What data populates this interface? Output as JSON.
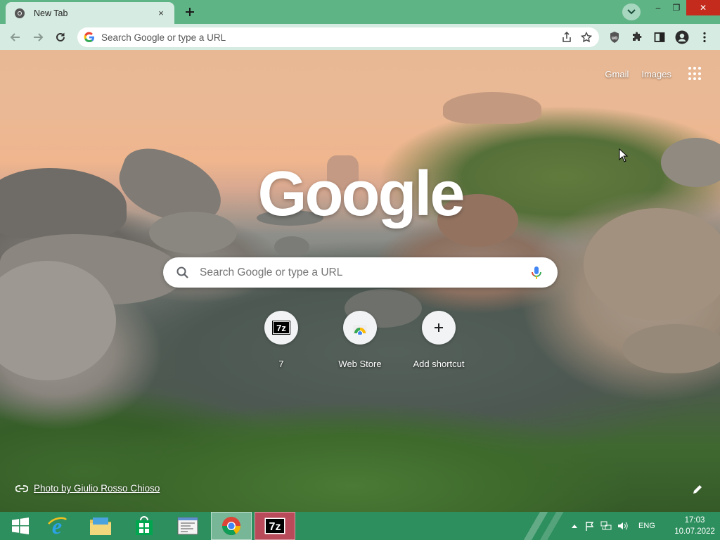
{
  "browser": {
    "tab": {
      "title": "New Tab",
      "close_label": "×"
    },
    "omnibox": {
      "placeholder": "Search Google or type a URL"
    },
    "window_controls": {
      "minimize": "–",
      "restore": "❐",
      "close": "✕"
    }
  },
  "ntp": {
    "links": {
      "gmail": "Gmail",
      "images": "Images"
    },
    "logo": "Google",
    "search": {
      "placeholder": "Search Google or type a URL"
    },
    "shortcuts": [
      {
        "label": "7",
        "icon": "7zip-icon"
      },
      {
        "label": "Web Store",
        "icon": "chrome-web-store-icon"
      },
      {
        "label": "Add shortcut",
        "icon": "plus-icon"
      }
    ],
    "credit": "Photo by Giulio Rosso Chioso"
  },
  "taskbar": {
    "apps": [
      "start",
      "internet-explorer",
      "file-explorer",
      "store",
      "documents",
      "chrome",
      "7zip"
    ],
    "language": "ENG",
    "time": "17:03",
    "date": "10.07.2022"
  },
  "colors": {
    "tab_strip": "#5fb486",
    "toolbar": "#d6ebe1",
    "taskbar": "#2e8f5e",
    "close_red": "#c42b1c"
  }
}
